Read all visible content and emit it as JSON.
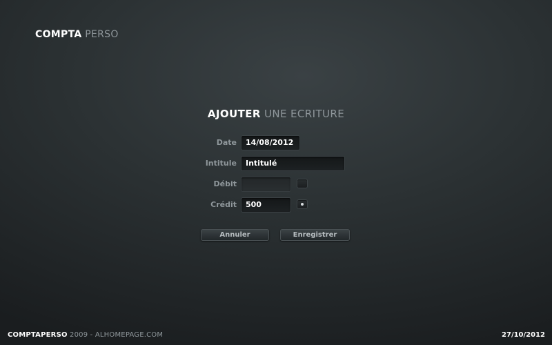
{
  "header": {
    "brand_strong": "COMPTA",
    "brand_soft": " PERSO"
  },
  "form": {
    "title_strong": "AJOUTER",
    "title_soft": " UNE ECRITURE",
    "date": {
      "label": "Date",
      "value": "14/08/2012"
    },
    "intitule": {
      "label": "Intitule",
      "value": "Intitulé"
    },
    "debit": {
      "label": "Débit",
      "value": "",
      "selected": false
    },
    "credit": {
      "label": "Crédit",
      "value": "500",
      "selected": true
    },
    "cancel_label": "Annuler",
    "save_label": "Enregistrer"
  },
  "footer": {
    "app_name": "COMPTAPERSO",
    "credit_text": " 2009 - ALHOMEPAGE.COM",
    "date": "27/10/2012"
  }
}
